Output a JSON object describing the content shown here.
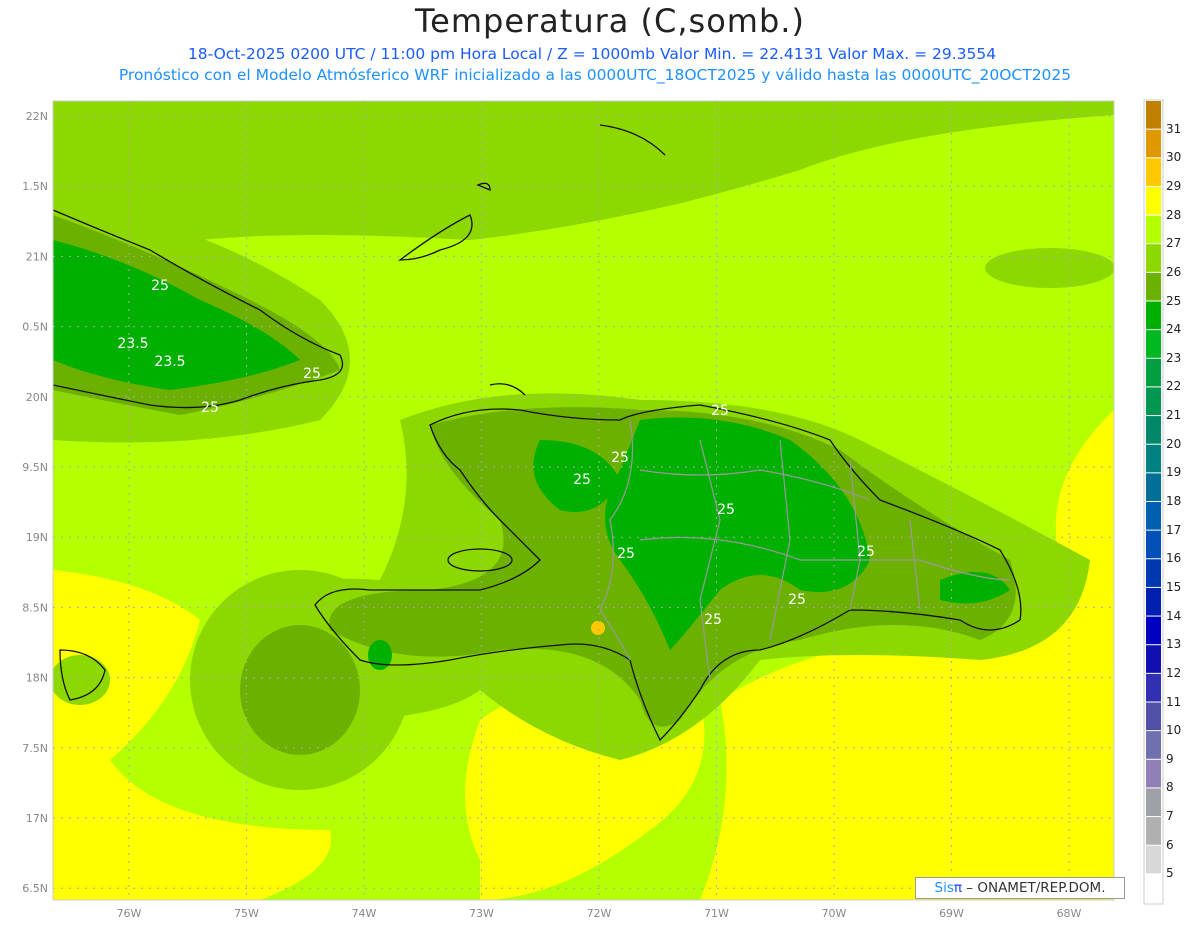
{
  "header": {
    "title": "Temperatura (C,somb.)",
    "subtitle1": "18-Oct-2025 0200 UTC / 11:00 pm Hora Local / Z = 1000mb  Valor Min. = 22.4131  Valor Max. = 29.3554",
    "subtitle2": "Pronóstico con el Modelo Atmósferico WRF inicializado a las 0000UTC_18OCT2025 y válido hasta las  0000UTC_20OCT2025"
  },
  "axes": {
    "lat_labels": [
      "22N",
      "1.5N",
      "21N",
      "0.5N",
      "20N",
      "9.5N",
      "19N",
      "8.5N",
      "18N",
      "7.5N",
      "17N",
      "6.5N"
    ],
    "lon_labels": [
      "76W",
      "75W",
      "74W",
      "73W",
      "72W",
      "71W",
      "70W",
      "69W",
      "68W"
    ]
  },
  "contour_labels": [
    "25",
    "23.5",
    "23.5",
    "25",
    "25",
    "25",
    "25",
    "25",
    "25",
    "25",
    "25",
    "25",
    "25"
  ],
  "colorbar": {
    "labels": [
      "31",
      "30",
      "29",
      "28",
      "27",
      "26",
      "25",
      "24",
      "23",
      "22",
      "21",
      "20",
      "19",
      "18",
      "17",
      "16",
      "15",
      "14",
      "13",
      "12",
      "11",
      "10",
      "9",
      "8",
      "7",
      "6",
      "5"
    ],
    "colors": [
      "#c08000",
      "#e09800",
      "#ffc800",
      "#ffff00",
      "#b4ff00",
      "#8cd800",
      "#6cb000",
      "#00b000",
      "#00b820",
      "#00a040",
      "#009850",
      "#008868",
      "#008080",
      "#007098",
      "#0060b0",
      "#0050b8",
      "#0038b0",
      "#0020b0",
      "#0000c0",
      "#1010b0",
      "#3030b0",
      "#5050a8",
      "#7070b0",
      "#9080b8",
      "#a0a0a8",
      "#b0b0b0",
      "#d8d8d8",
      "#ffffff"
    ]
  },
  "credit": {
    "sis": "Sis",
    "pi": "π",
    "text": " –  ONAMET/REP.DOM."
  }
}
